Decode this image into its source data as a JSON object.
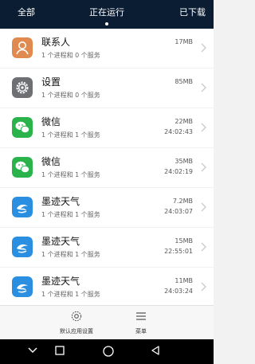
{
  "tabs": {
    "left": "全部",
    "center": "正在运行",
    "right": "已下载"
  },
  "apps": [
    {
      "name": "联系人",
      "sub": "1 个进程和 0 个服务",
      "size": "17MB",
      "time": "",
      "icon": "contacts-icon",
      "color": "#e08a4f"
    },
    {
      "name": "设置",
      "sub": "1 个进程和 0 个服务",
      "size": "85MB",
      "time": "",
      "icon": "settings-gear-icon",
      "color": "#6d6f73"
    },
    {
      "name": "微信",
      "sub": "1 个进程和 1 个服务",
      "size": "22MB",
      "time": "24:02:43",
      "icon": "wechat-icon",
      "color": "#2ab24b"
    },
    {
      "name": "微信",
      "sub": "1 个进程和 1 个服务",
      "size": "35MB",
      "time": "24:02:19",
      "icon": "wechat-icon",
      "color": "#2ab24b"
    },
    {
      "name": "墨迹天气",
      "sub": "1 个进程和 1 个服务",
      "size": "7.2MB",
      "time": "24:03:07",
      "icon": "moji-weather-icon",
      "color": "#2a8fe0"
    },
    {
      "name": "墨迹天气",
      "sub": "1 个进程和 1 个服务",
      "size": "15MB",
      "time": "22:55:01",
      "icon": "moji-weather-icon",
      "color": "#2a8fe0"
    },
    {
      "name": "墨迹天气",
      "sub": "1 个进程和 1 个服务",
      "size": "11MB",
      "time": "24:03:24",
      "icon": "moji-weather-icon",
      "color": "#2a8fe0"
    }
  ],
  "bottom": {
    "settings_label": "默认应用设置",
    "menu_label": "菜单"
  }
}
